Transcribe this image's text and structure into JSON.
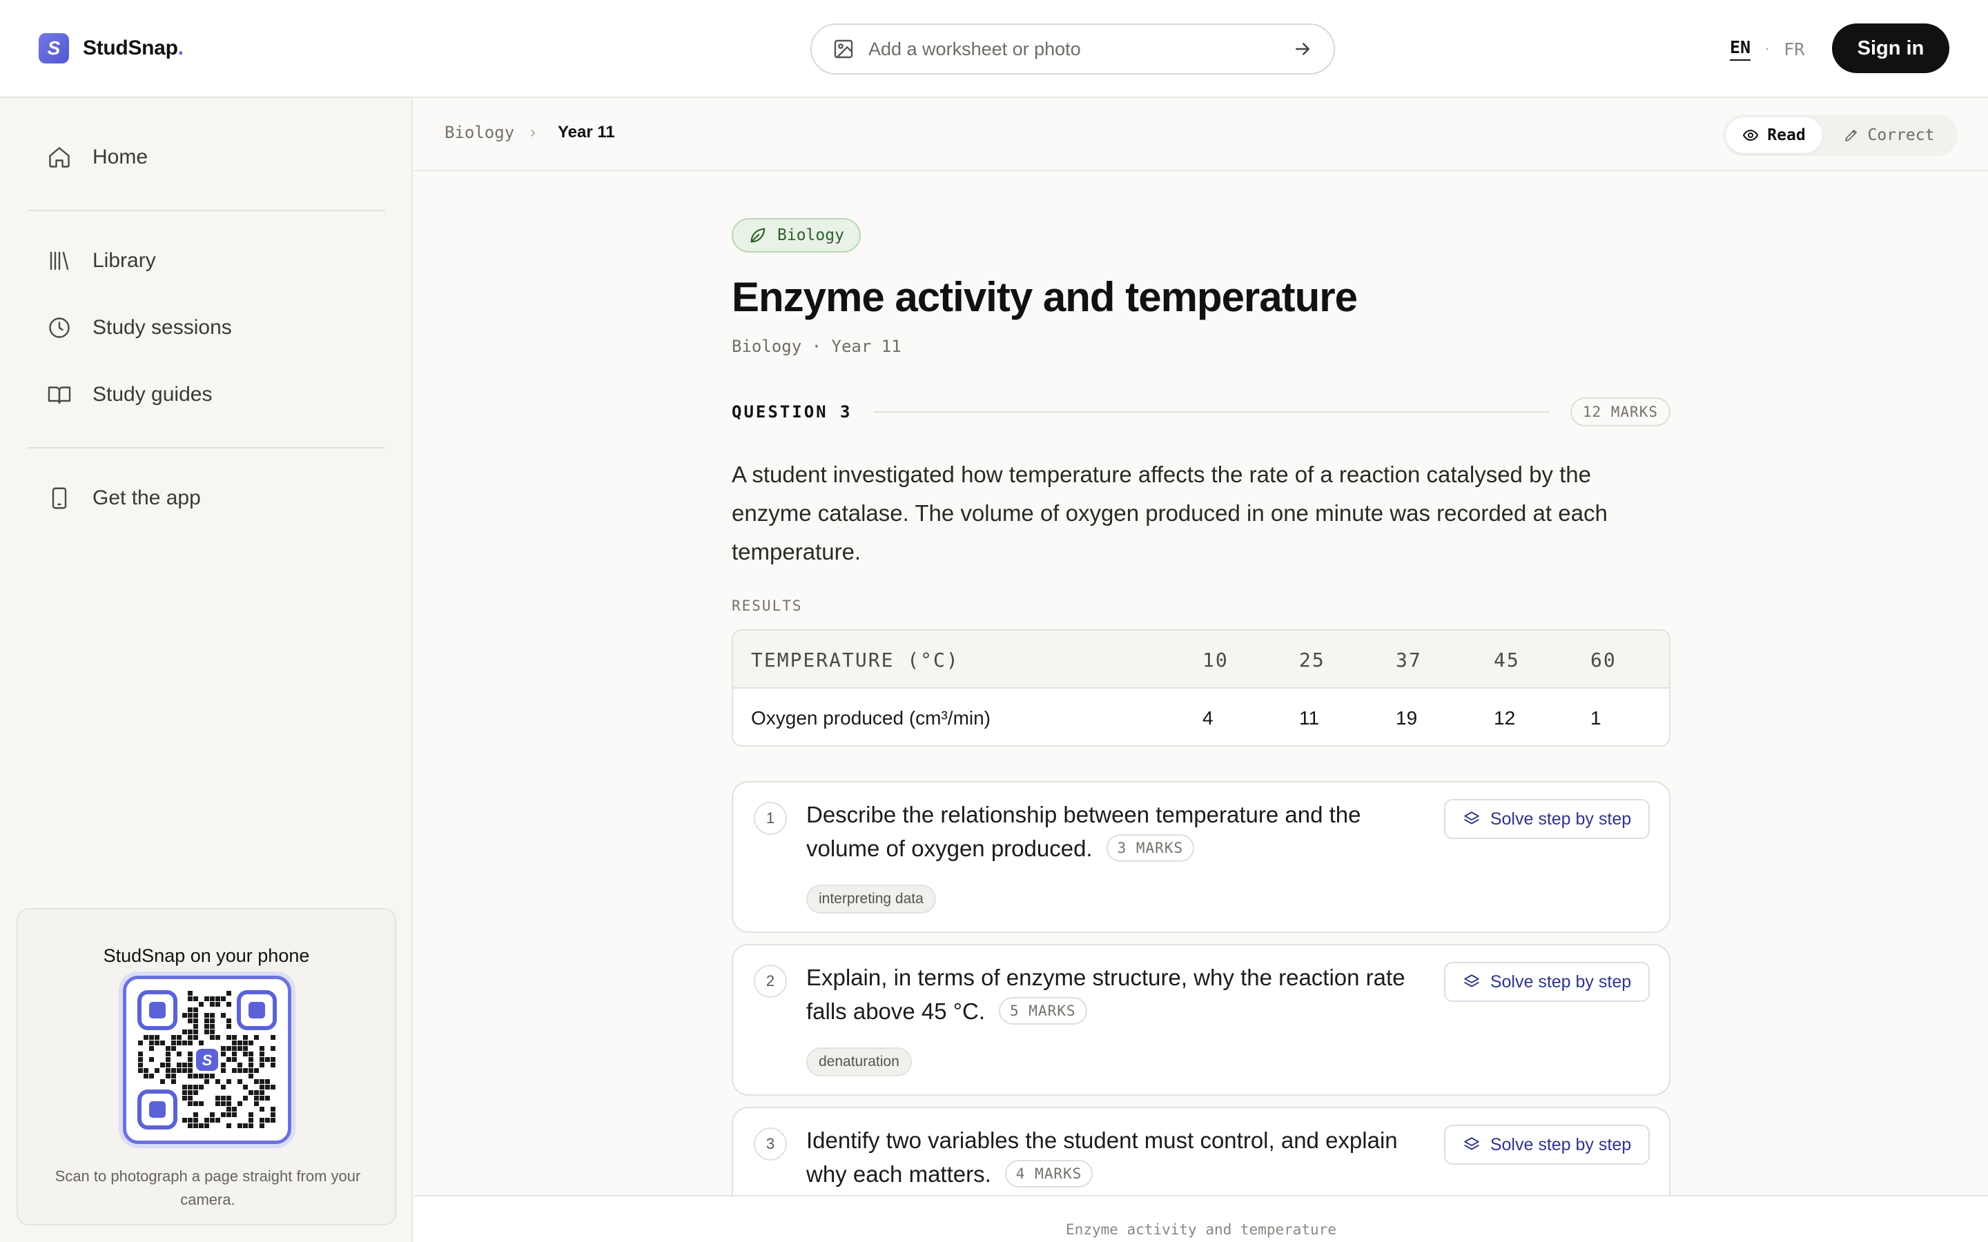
{
  "brand": {
    "name": "StudSnap",
    "name_dot": ".",
    "mark": "S"
  },
  "upload": {
    "placeholder": "Add a worksheet or photo",
    "icon": "image-icon",
    "submit_icon": "arrow-right-icon"
  },
  "lang": {
    "active": "EN",
    "separator": "·",
    "other": "FR"
  },
  "auth": {
    "sign_in_label": "Sign in"
  },
  "sidebar": {
    "items": [
      {
        "label": "Home",
        "icon": "home-icon"
      },
      {
        "label": "Library",
        "icon": "library-icon"
      },
      {
        "label": "Study sessions",
        "icon": "clock-icon"
      },
      {
        "label": "Study guides",
        "icon": "book-open-icon"
      },
      {
        "label": "Get the app",
        "icon": "phone-icon"
      }
    ],
    "app_card": {
      "title": "StudSnap on your phone",
      "qr_center": "S",
      "note": "Scan to photograph a page straight from your camera."
    }
  },
  "breadcrumb": {
    "items": [
      "Biology",
      "Year 11"
    ],
    "separator": "›"
  },
  "mode_toggle": {
    "read": "Read",
    "correct": "Correct",
    "active": "Read"
  },
  "article": {
    "subject_tag": "Biology",
    "title": "Enzyme activity and temperature",
    "meta": "Biology · Year 11",
    "question_label": "QUESTION 3",
    "question_marks": "12 MARKS",
    "stem": "A student investigated how temperature affects the rate of a reaction catalysed by the enzyme catalase. The volume of oxygen produced in one minute was recorded at each temperature.",
    "results_label": "RESULTS",
    "table": {
      "header": "TEMPERATURE (°C)",
      "columns": [
        "10",
        "25",
        "37",
        "45",
        "60"
      ],
      "row_label": "Oxygen produced (cm³/min)",
      "row_values": [
        "4",
        "11",
        "19",
        "12",
        "1"
      ]
    },
    "parts": [
      {
        "number": "1",
        "text": "Describe the relationship between temperature and the volume of oxygen produced.",
        "marks": "3 MARKS",
        "tag": "interpreting data",
        "action": "Solve step by step"
      },
      {
        "number": "2",
        "text": "Explain, in terms of enzyme structure, why the reaction rate falls above 45 °C.",
        "marks": "5 MARKS",
        "tag": "denaturation",
        "action": "Solve step by step"
      },
      {
        "number": "3",
        "text": "Identify two variables the student must control, and explain why each matters.",
        "marks": "4 MARKS",
        "tag": "",
        "action": "Solve step by step"
      }
    ]
  },
  "footer": {
    "text": "Enzyme activity and temperature"
  },
  "colors": {
    "accent": "#5b62d8",
    "ink": "#111111",
    "biology_tag_bg": "#e8f2e6",
    "biology_tag_fg": "#2f5f2a",
    "action_text": "#2f348c"
  }
}
